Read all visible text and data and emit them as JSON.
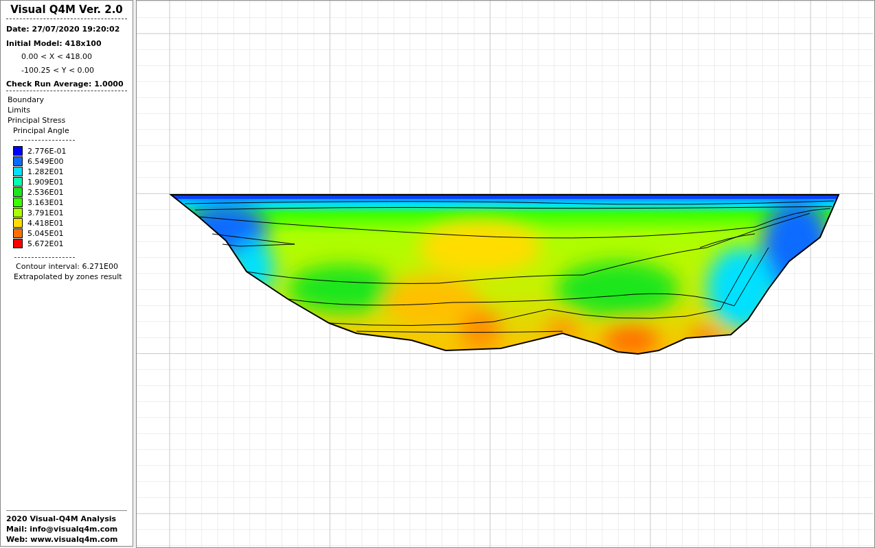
{
  "panel": {
    "title": "Visual Q4M Ver. 2.0",
    "date": "Date: 27/07/2020 19:20:02",
    "model": "Initial Model: 418x100",
    "x_range": "0.00 < X < 418.00",
    "y_range": "-100.25 < Y < 0.00",
    "check": "Check Run Average: 1.0000",
    "layers": [
      "Boundary",
      "Limits",
      "Principal Stress"
    ],
    "sublayer": "Principal Angle",
    "legend": [
      {
        "label": "2.776E-01",
        "color": "#0000ff"
      },
      {
        "label": "6.549E00",
        "color": "#0a6cff"
      },
      {
        "label": "1.282E01",
        "color": "#00e0ff"
      },
      {
        "label": "1.909E01",
        "color": "#00ffae"
      },
      {
        "label": "2.536E01",
        "color": "#1ee61e"
      },
      {
        "label": "3.163E01",
        "color": "#3cff00"
      },
      {
        "label": "3.791E01",
        "color": "#aaff00"
      },
      {
        "label": "4.418E01",
        "color": "#ffdd00"
      },
      {
        "label": "5.045E01",
        "color": "#ff7000"
      },
      {
        "label": "5.672E01",
        "color": "#ff0000"
      }
    ],
    "contour_interval": "Contour interval: 6.271E00",
    "extrapolation": "Extrapolated by zones result",
    "footer": [
      "2020 Visual-Q4M Analysis",
      "Mail: info@visualq4m.com",
      "Web: www.visualq4m.com"
    ]
  }
}
